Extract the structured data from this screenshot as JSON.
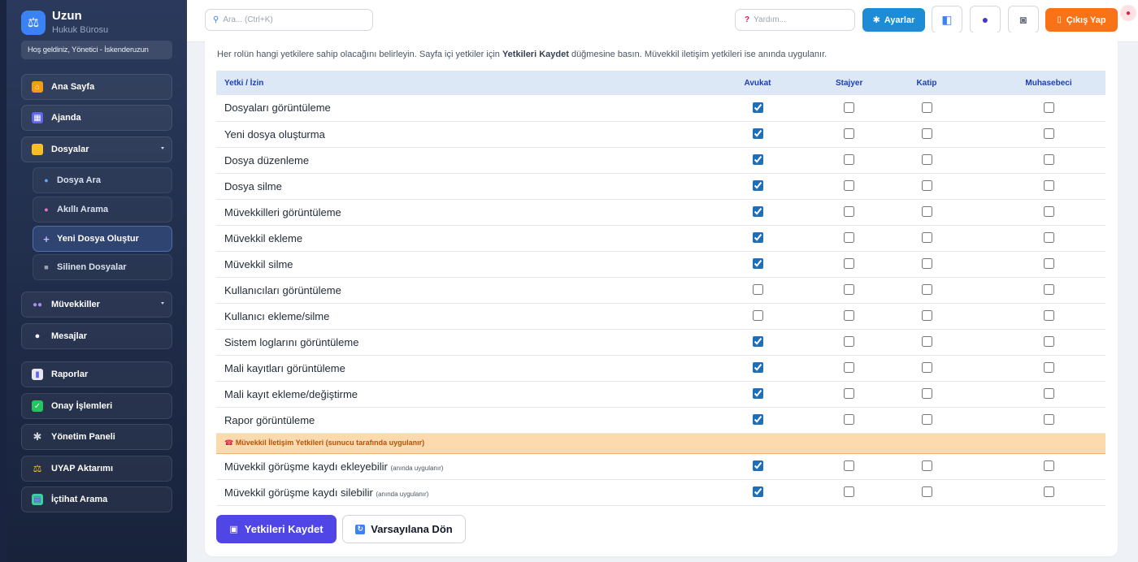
{
  "brand": {
    "name": "Uzun",
    "subtitle": "Hukuk Bürosu",
    "logo_icon": "scales-icon"
  },
  "welcome": "Hoş geldiniz, Yönetici - İskenderuzun",
  "sidebar": {
    "items": [
      {
        "label": "Ana Sayfa",
        "icon": "house-icon"
      },
      {
        "label": "Ajanda",
        "icon": "calendar-icon"
      },
      {
        "label": "Dosyalar",
        "icon": "folder-icon",
        "expanded": true
      },
      {
        "label": "Müvekkiller",
        "icon": "people-icon"
      },
      {
        "label": "Mesajlar",
        "icon": "speech-bubble-icon"
      },
      {
        "label": "Raporlar",
        "icon": "bar-chart-icon"
      },
      {
        "label": "Onay İşlemleri",
        "icon": "check-box-icon"
      },
      {
        "label": "Yönetim Paneli",
        "icon": "gear-icon"
      },
      {
        "label": "UYAP Aktarımı",
        "icon": "scales-icon"
      },
      {
        "label": "İçtihat Arama",
        "icon": "books-icon"
      }
    ],
    "subitems": [
      {
        "label": "Dosya Ara",
        "icon": "magnifier-icon"
      },
      {
        "label": "Akıllı Arama",
        "icon": "brain-icon"
      },
      {
        "label": "Yeni Dosya Oluştur",
        "icon": "plus-icon",
        "active": true
      },
      {
        "label": "Silinen Dosyalar",
        "icon": "trash-icon"
      }
    ]
  },
  "topbar": {
    "search_placeholder": "Ara... (Ctrl+K)",
    "help_placeholder": "Yardım...",
    "settings_label": "Ayarlar",
    "logout_label": "Çıkış Yap",
    "icons": [
      "chat-user-icon",
      "user-icon",
      "robot-icon"
    ]
  },
  "content": {
    "description_prefix": "Her rolün hangi yetkilere sahip olacağını belirleyin. Sayfa içi yetkiler için ",
    "description_bold": "Yetkileri Kaydet",
    "description_suffix": " düğmesine basın. Müvekkil iletişim yetkileri ise anında uygulanır.",
    "table": {
      "headers": [
        "Yetki / İzin",
        "Avukat",
        "Stajyer",
        "Katip",
        "Muhasebeci"
      ],
      "rows": [
        {
          "label": "Dosyaları görüntüleme",
          "perms": [
            true,
            false,
            false,
            false
          ]
        },
        {
          "label": "Yeni dosya oluşturma",
          "perms": [
            true,
            false,
            false,
            false
          ]
        },
        {
          "label": "Dosya düzenleme",
          "perms": [
            true,
            false,
            false,
            false
          ]
        },
        {
          "label": "Dosya silme",
          "perms": [
            true,
            false,
            false,
            false
          ]
        },
        {
          "label": "Müvekkilleri görüntüleme",
          "perms": [
            true,
            false,
            false,
            false
          ]
        },
        {
          "label": "Müvekkil ekleme",
          "perms": [
            true,
            false,
            false,
            false
          ]
        },
        {
          "label": "Müvekkil silme",
          "perms": [
            true,
            false,
            false,
            false
          ]
        },
        {
          "label": "Kullanıcıları görüntüleme",
          "perms": [
            false,
            false,
            false,
            false
          ]
        },
        {
          "label": "Kullanıcı ekleme/silme",
          "perms": [
            false,
            false,
            false,
            false
          ]
        },
        {
          "label": "Sistem loglarını görüntüleme",
          "perms": [
            true,
            false,
            false,
            false
          ]
        },
        {
          "label": "Mali kayıtları görüntüleme",
          "perms": [
            true,
            false,
            false,
            false
          ]
        },
        {
          "label": "Mali kayıt ekleme/değiştirme",
          "perms": [
            true,
            false,
            false,
            false
          ]
        },
        {
          "label": "Rapor görüntüleme",
          "perms": [
            true,
            false,
            false,
            false
          ]
        }
      ],
      "section_label": "Müvekkil İletişim Yetkileri (sunucu tarafında uygulanır)",
      "section_icon": "phone-icon",
      "client_rows": [
        {
          "label": "Müvekkil görüşme kaydı ekleyebilir",
          "note": "(anında uygulanır)",
          "perms": [
            true,
            false,
            false,
            false
          ]
        },
        {
          "label": "Müvekkil görüşme kaydı silebilir",
          "note": "(anında uygulanır)",
          "perms": [
            true,
            false,
            false,
            false
          ]
        }
      ]
    },
    "save_label": "Yetkileri Kaydet",
    "reset_label": "Varsayılana Dön"
  },
  "colors": {
    "accent": "#1d8bd6",
    "save": "#4f46e5",
    "logout": "#f97316",
    "section": "#fdd9ae"
  }
}
